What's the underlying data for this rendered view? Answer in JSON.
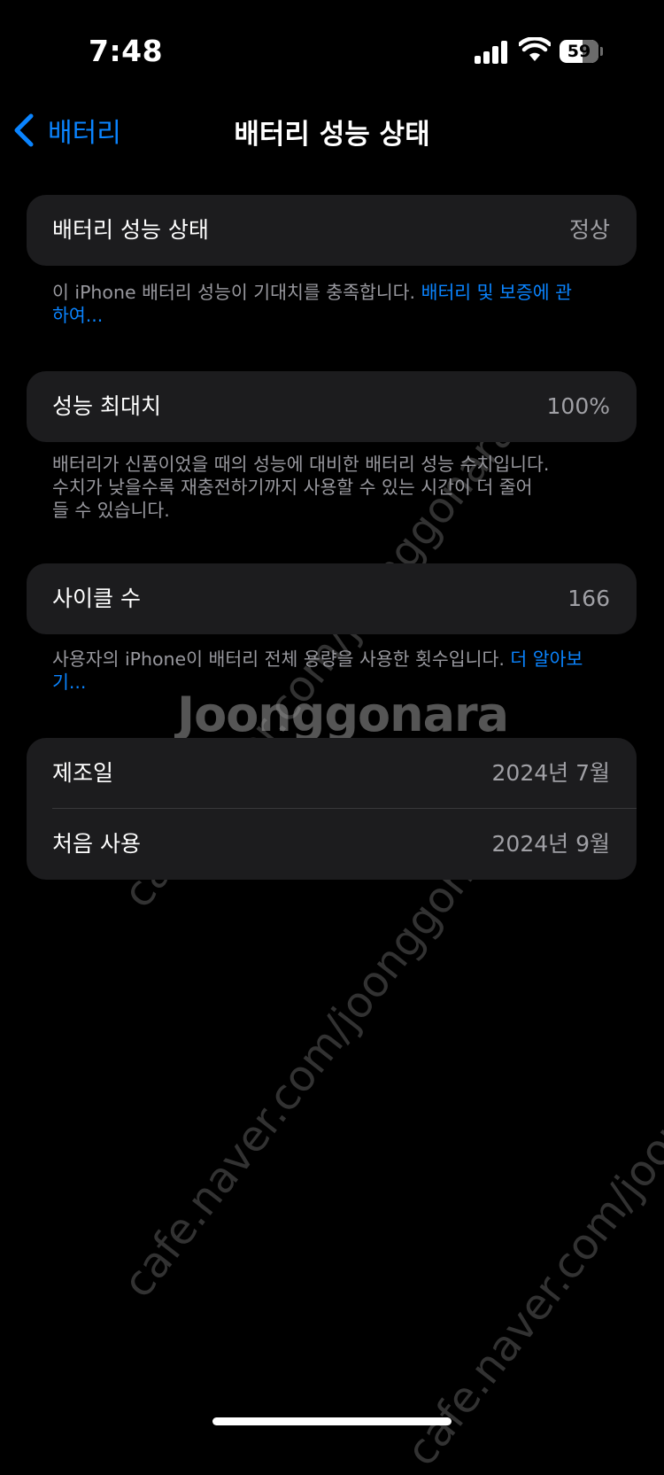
{
  "status_bar": {
    "time": "7:48",
    "battery_level": "59"
  },
  "nav": {
    "back_label": "배터리",
    "title": "배터리 성능 상태"
  },
  "health_card": {
    "label": "배터리 성능 상태",
    "value": "정상"
  },
  "health_note": {
    "text": "이 iPhone 배터리 성능이 기대치를 충족합니다. ",
    "link": "배터리 및 보증에 관하여..."
  },
  "capacity_card": {
    "label": "성능 최대치",
    "value": "100%"
  },
  "capacity_note": {
    "lines": [
      "배터리가 신품이었을 때의 성능에 대비한 배터리 성능 수치입니다.",
      "수치가 낮을수록 재충전하기까지 사용할 수 있는 시간이 더 줄어",
      "들 수 있습니다."
    ]
  },
  "cycle_card": {
    "label": "사이클 수",
    "value": "166"
  },
  "cycle_note": {
    "text": "사용자의 iPhone이 배터리 전체 용량을 사용한 횟수입니다. ",
    "link": "더 알아보기..."
  },
  "dates_card": {
    "manufactured_label": "제조일",
    "manufactured_value": "2024년 7월",
    "first_use_label": "처음 사용",
    "first_use_value": "2024년 9월"
  },
  "watermark": {
    "logo": "Joonggonara",
    "url": "cafe.naver.com/joonggonara"
  }
}
